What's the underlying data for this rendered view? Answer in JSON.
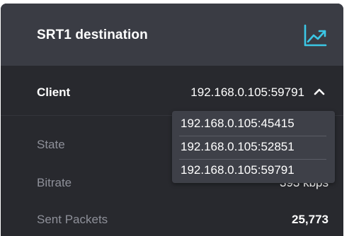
{
  "panel": {
    "title": "SRT1 destination",
    "chart_icon": "line-chart-icon",
    "accent_color": "#3bc7e6"
  },
  "client": {
    "label": "Client",
    "selected": "192.168.0.105:59791",
    "expanded": true,
    "options": [
      "192.168.0.105:45415",
      "192.168.0.105:52851",
      "192.168.0.105:59791"
    ]
  },
  "stats": {
    "state_label": "State",
    "bitrate_label": "Bitrate",
    "bitrate_value": "393 kbps",
    "sent_packets_label": "Sent Packets",
    "sent_packets_value": "25,773"
  }
}
